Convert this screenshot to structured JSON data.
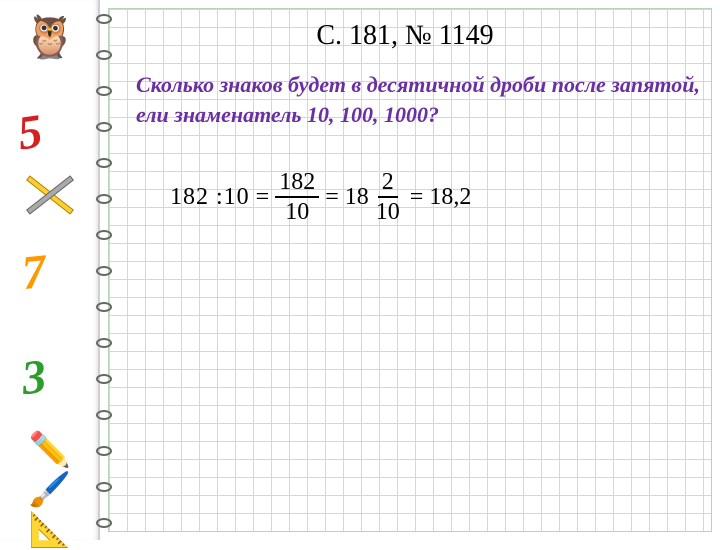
{
  "header": {
    "title": "С. 181, № 1149"
  },
  "question": {
    "text": "Сколько знаков будет в десятичной дроби после запятой, ели знаменатель 10, 100, 1000?"
  },
  "equation": {
    "lhs": "182 :10",
    "eq1": "=",
    "frac1": {
      "num": "182",
      "den": "10"
    },
    "eq2": "=",
    "mixed_whole": "18",
    "frac2": {
      "num": "2",
      "den": "10"
    },
    "eq3": "=",
    "result": "18,2"
  },
  "sidebar": {
    "owl": "🦉",
    "n5": "5",
    "n7": "7",
    "n3": "3",
    "tools": "✏️🖌️📐"
  }
}
